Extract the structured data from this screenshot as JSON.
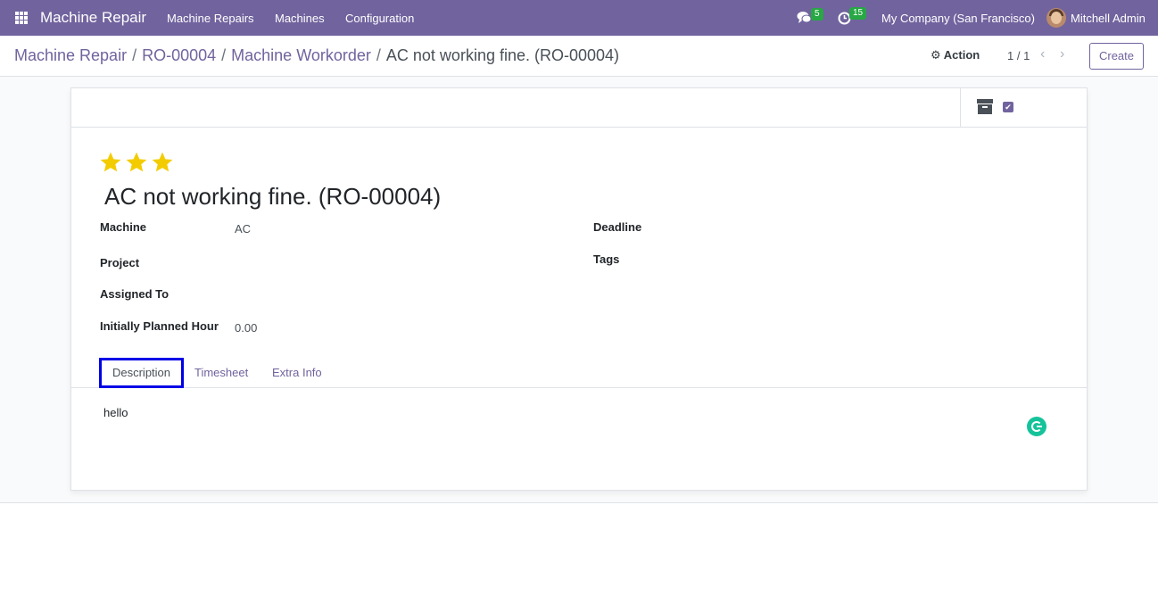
{
  "navbar": {
    "app_name": "Machine Repair",
    "menu": [
      "Machine Repairs",
      "Machines",
      "Configuration"
    ],
    "messages_count": "5",
    "activities_count": "15",
    "company": "My Company (San Francisco)",
    "user": "Mitchell Admin"
  },
  "breadcrumb": {
    "items": [
      "Machine Repair",
      "RO-00004",
      "Machine Workorder"
    ],
    "current": "AC not working fine. (RO-00004)"
  },
  "control": {
    "action_label": "Action",
    "pager": "1 / 1",
    "create_label": "Create"
  },
  "record": {
    "stars": 3,
    "title": "AC not working fine. (RO-00004)",
    "fields": {
      "machine_label": "Machine",
      "machine_value": "AC",
      "project_label": "Project",
      "assigned_label": "Assigned To",
      "planned_label": "Initially Planned Hour",
      "planned_value": "0.00",
      "deadline_label": "Deadline",
      "tags_label": "Tags"
    }
  },
  "tabs": {
    "items": [
      "Description",
      "Timesheet",
      "Extra Info"
    ],
    "active": "Description"
  },
  "description": {
    "text": "hello"
  },
  "colors": {
    "navbar": "#71639e",
    "accent": "#71639e",
    "star": "#f3cc00",
    "badge": "#28a745",
    "focus_outline": "#0000e6"
  },
  "icons": [
    "apps-grid-icon",
    "chat-icon",
    "clock-icon",
    "gear-icon",
    "chevron-left-icon",
    "chevron-right-icon",
    "archive-icon",
    "checkbox-icon",
    "star-icon",
    "grammarly-icon"
  ]
}
